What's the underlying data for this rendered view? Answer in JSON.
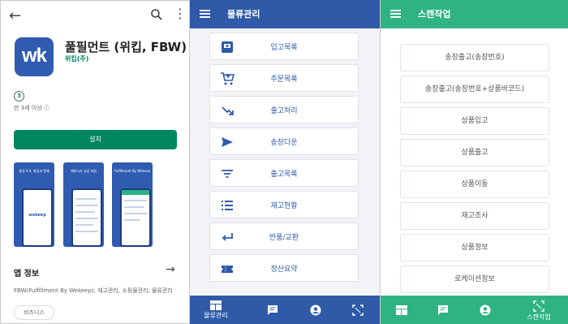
{
  "playstore": {
    "app_title": "풀필먼트 (위킵, FBW)",
    "developer": "위킵(주)",
    "logo_text": "wk",
    "rating_badge": "3",
    "rating_label": "만 3세 이상 ⓘ",
    "install_label": "설치",
    "screenshots": [
      {
        "caption": "물류 4.0, 위킵과 함께",
        "sub": "",
        "brand": "wekeep"
      },
      {
        "caption": "해외시사 성공 지원",
        "sub": "",
        "brand": ""
      },
      {
        "caption": "Fulfillment By Wekeep",
        "sub": "",
        "brand": ""
      }
    ],
    "info_title": "앱 정보",
    "description": "FBW(Fulfillment By Wekeep), 재고관리, 소핑몰관리, 물류관리",
    "category_chip": "비즈니스",
    "icons": {
      "back": "back-arrow-icon",
      "search": "search-icon",
      "more": "more-vert-icon",
      "info_arrow": "arrow-right-icon"
    }
  },
  "logistics": {
    "title": "물류관리",
    "header_color": "#2e5aa8",
    "items": [
      {
        "label": "입고목록",
        "icon": "inbox-icon"
      },
      {
        "label": "주문목록",
        "icon": "cart-icon"
      },
      {
        "label": "출고처리",
        "icon": "trend-arrow-icon"
      },
      {
        "label": "송장다운",
        "icon": "send-icon"
      },
      {
        "label": "출고목록",
        "icon": "filter-icon"
      },
      {
        "label": "재고현황",
        "icon": "list-icon"
      },
      {
        "label": "반품/교환",
        "icon": "return-icon"
      },
      {
        "label": "정산요약",
        "icon": "ticket-icon"
      }
    ],
    "nav": [
      {
        "label": "물류관리",
        "icon": "dashboard-icon"
      },
      {
        "label": "",
        "icon": "chat-icon"
      },
      {
        "label": "",
        "icon": "account-icon"
      },
      {
        "label": "",
        "icon": "scan-icon"
      }
    ]
  },
  "scan": {
    "title": "스캔작업",
    "header_color": "#2fb383",
    "items": [
      {
        "label": "송장출고(송장번호)"
      },
      {
        "label": "송장출고(송장번호+상품바코드)"
      },
      {
        "label": "상품입고"
      },
      {
        "label": "상품출고"
      },
      {
        "label": "상품이동"
      },
      {
        "label": "재고조사"
      },
      {
        "label": "상품정보"
      },
      {
        "label": "로케이션정보"
      }
    ],
    "nav": [
      {
        "label": "",
        "icon": "dashboard-icon"
      },
      {
        "label": "",
        "icon": "chat-icon"
      },
      {
        "label": "",
        "icon": "account-icon"
      },
      {
        "label": "스캔작업",
        "icon": "scan-icon"
      }
    ]
  }
}
